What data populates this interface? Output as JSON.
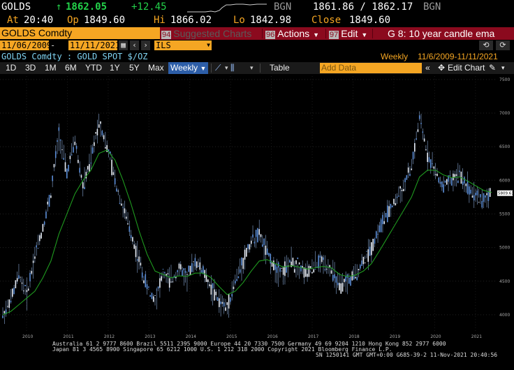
{
  "header": {
    "ticker": "GOLDS",
    "arrow": "↑",
    "last": "1862.05",
    "change": "+12.45",
    "src1": "BGN",
    "bid_ask": "1861.86 / 1862.17",
    "src2": "BGN",
    "at_label": "At",
    "at_value": "20:40",
    "op_label": "Op",
    "op_value": "1849.60",
    "hi_label": "Hi",
    "hi_value": "1866.02",
    "lo_label": "Lo",
    "lo_value": "1842.98",
    "close_label": "Close",
    "close_value": "1849.60"
  },
  "security": {
    "name": "GOLDS Comdty"
  },
  "menu": {
    "suggested_num": "94",
    "suggested_label": "Suggested Charts",
    "actions_num": "96",
    "actions_label": "Actions",
    "edit_num": "97",
    "edit_label": "Edit",
    "chart_name": "G 8: 10 year candle ema"
  },
  "range": {
    "start": "11/06/2009",
    "end": "11/11/2021",
    "currency": "ILS"
  },
  "subtitle": {
    "security_desc": "GOLDS Comdty : GOLD SPOT $/OZ",
    "period_label": "Weekly",
    "period_range": "11/6/2009-11/11/2021"
  },
  "toolbar": {
    "periods": [
      "1D",
      "3D",
      "1M",
      "6M",
      "YTD",
      "1Y",
      "5Y",
      "Max"
    ],
    "frequency": "Weekly",
    "table_label": "Table",
    "add_data_placeholder": "Add Data",
    "edit_chart_label": "Edit Chart"
  },
  "colors": {
    "accent": "#f5a623",
    "menu_bar": "#8b0a1e",
    "up": "#23d24a",
    "candle": "#6e9bd6",
    "ema": "#1f9a1f"
  },
  "chart_data": {
    "type": "line",
    "series": [
      {
        "values": [
          4000,
          4200,
          4600,
          4300,
          4900,
          5300,
          5800,
          6700,
          6100,
          6600,
          5900,
          6300,
          6900,
          6500,
          6000,
          5600,
          5200,
          4800,
          4400,
          4250,
          4600,
          4500,
          4700,
          4550,
          4800,
          4650,
          4400,
          4200,
          4100,
          4500,
          4800,
          5100,
          5200,
          4900,
          4700,
          4650,
          4800,
          4700,
          4600,
          4750,
          4800,
          4650,
          4400,
          4500,
          4600,
          4800,
          5000,
          5300,
          5500,
          5700,
          5900,
          6200,
          6900,
          6400,
          6100,
          5900,
          6000,
          6100,
          5900,
          5800,
          5700,
          5809
        ]
      },
      {
        "values": [
          4000,
          4050,
          4150,
          4250,
          4350,
          4550,
          4800,
          5200,
          5500,
          5800,
          6000,
          6150,
          6400,
          6450,
          6300,
          6000,
          5650,
          5250,
          4900,
          4650,
          4600,
          4550,
          4580,
          4570,
          4620,
          4620,
          4550,
          4420,
          4300,
          4350,
          4480,
          4650,
          4800,
          4820,
          4760,
          4710,
          4730,
          4710,
          4680,
          4700,
          4720,
          4700,
          4600,
          4570,
          4590,
          4650,
          4760,
          4950,
          5150,
          5350,
          5550,
          5750,
          6050,
          6150,
          6150,
          6080,
          6040,
          6050,
          5990,
          5920,
          5850,
          5820
        ]
      }
    ],
    "y_ticks": [
      "7500",
      "7000",
      "6500",
      "6000",
      "5500",
      "5000",
      "4500",
      "4000"
    ],
    "x_ticks": [
      "2010",
      "2011",
      "2012",
      "2013",
      "2014",
      "2015",
      "2016",
      "2017",
      "2018",
      "2019",
      "2020",
      "2021"
    ],
    "ylim": [
      3750,
      7550
    ],
    "last_value_label": "5809.61",
    "grid": true
  },
  "footer": {
    "line1": "Australia 61 2 9777 8600 Brazil 5511 2395 9000 Europe 44 20 7330 7500 Germany 49 69 9204 1210 Hong Kong 852 2977 6000",
    "line2": "Japan 81 3 4565 8900       Singapore 65 6212 1000       U.S. 1 212 318 2000         Copyright 2021 Bloomberg Finance L.P.",
    "line3": "SN 1250141 GMT  GMT+0:00 G685-39-2 11-Nov-2021 20:40:56"
  }
}
